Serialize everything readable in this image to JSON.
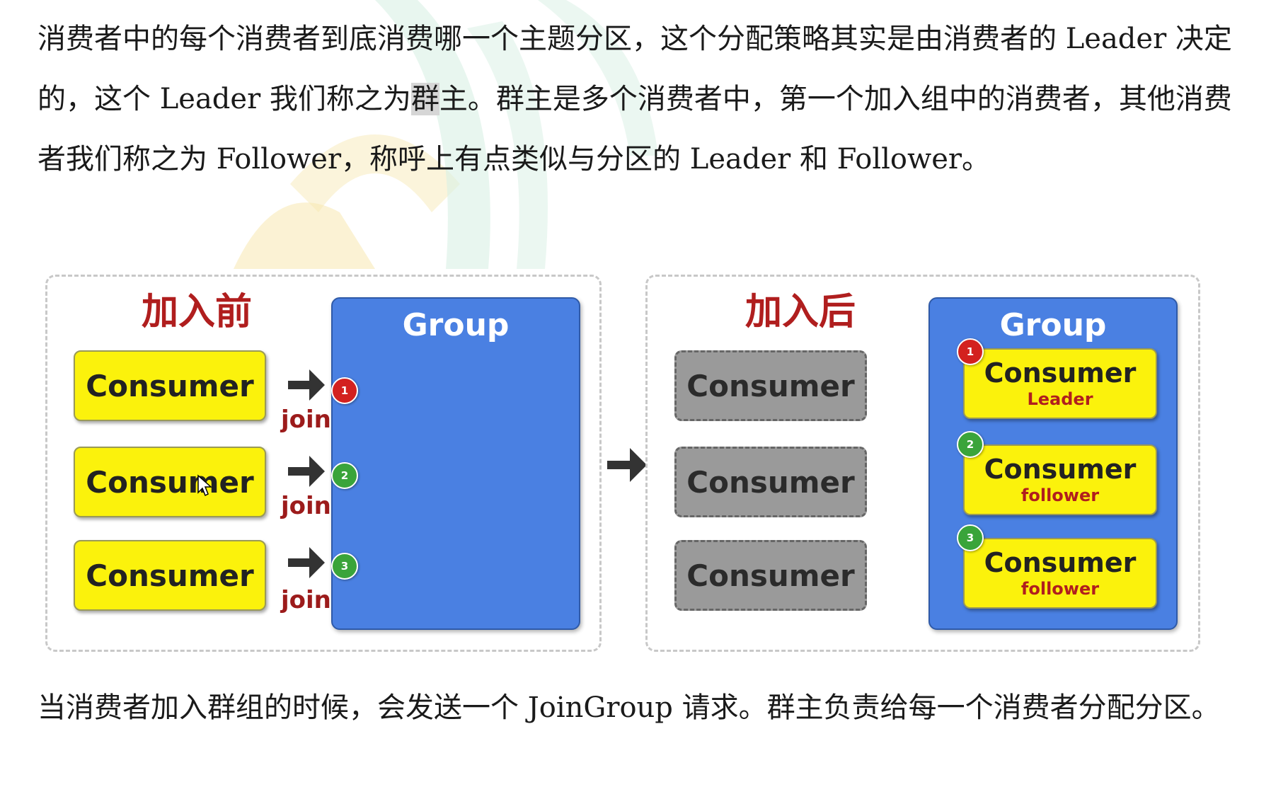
{
  "text": {
    "paragraph1_a": "消费者中的每个消费者到底消费哪一个主题分区，这个分配策略其实是由消费者的 Leader 决定的，这个 Leader 我们称之为",
    "paragraph1_hl": "群",
    "paragraph1_b": "主。群主是多个消费者中，第一个加入组中的消费者，其他消费者我们称之为 Follower，称呼上有点类似与分区的 Leader 和 Follower。",
    "paragraph2": "当消费者加入群组的时候，会发送一个 JoinGroup 请求。群主负责给每一个消费者分配分区。"
  },
  "diagram": {
    "before_title": "加入前",
    "after_title": "加入后",
    "group_label": "Group",
    "consumer_label": "Consumer",
    "join_label": "join",
    "badges": [
      "1",
      "2",
      "3"
    ],
    "members": [
      {
        "name": "Consumer",
        "role": "Leader"
      },
      {
        "name": "Consumer",
        "role": "follower"
      },
      {
        "name": "Consumer",
        "role": "follower"
      }
    ]
  },
  "colors": {
    "consumer": "#fbf20c",
    "group": "#4a80e2",
    "title_red": "#b01e1e",
    "badge_red": "#d3211f",
    "badge_green": "#3aa43a",
    "ghost": "#9a9a9a"
  }
}
